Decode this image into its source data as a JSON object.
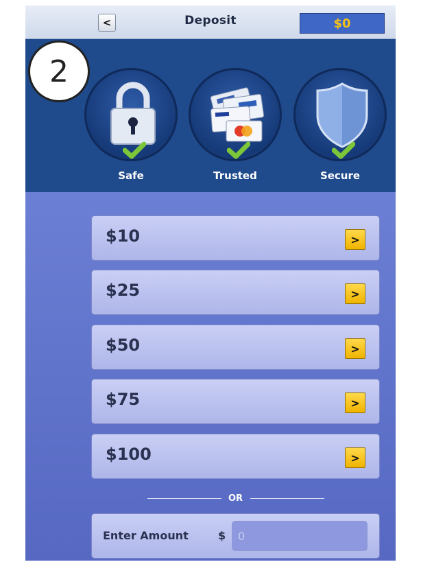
{
  "step_badge": "2",
  "header": {
    "back_label": "<",
    "title": "Deposit",
    "balance": "$0"
  },
  "trust": [
    {
      "label": "Safe",
      "icon": "padlock-icon"
    },
    {
      "label": "Trusted",
      "icon": "payment-cards-icon"
    },
    {
      "label": "Secure",
      "icon": "shield-icon"
    }
  ],
  "amounts": [
    {
      "label": "$10",
      "arrow": ">"
    },
    {
      "label": "$25",
      "arrow": ">"
    },
    {
      "label": "$50",
      "arrow": ">"
    },
    {
      "label": "$75",
      "arrow": ">"
    },
    {
      "label": "$100",
      "arrow": ">"
    }
  ],
  "or_text": "OR",
  "custom_amount": {
    "label": "Enter Amount",
    "currency": "$",
    "placeholder": "0"
  },
  "colors": {
    "accent_gold": "#f4c21a",
    "check_green": "#7cc63a",
    "band_blue": "#1f4a8c"
  }
}
